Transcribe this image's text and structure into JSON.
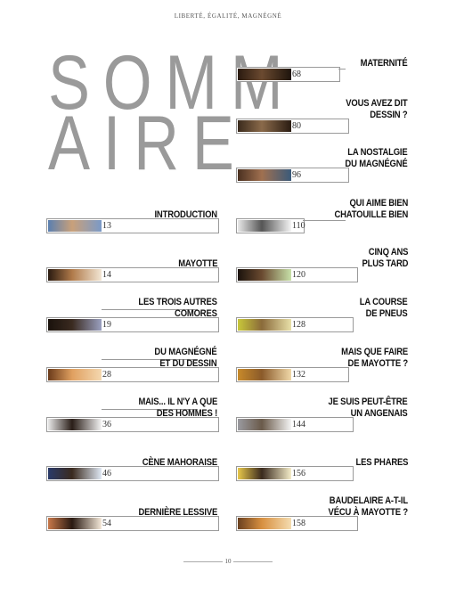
{
  "running_head": "LIBERTÉ, ÉGALITÉ, MAGNÉGNÉ",
  "title": {
    "line1": "SOMM",
    "line2": "AIRE"
  },
  "entries": [
    {
      "page": "68",
      "label": [
        "MATERNITÉ"
      ],
      "thumb_colors": [
        "#2a1a10",
        "#6b4a30",
        "#1e140c"
      ]
    },
    {
      "page": "80",
      "label": [
        "VOUS AVEZ DIT",
        "DESSIN ?"
      ],
      "thumb_colors": [
        "#3a2a1c",
        "#8a6a4a",
        "#2a1c12"
      ]
    },
    {
      "page": "96",
      "label": [
        "LA NOSTALGIE",
        "DU MAGNÉGNÉ"
      ],
      "thumb_colors": [
        "#4a3020",
        "#a07050",
        "#3a5a7a"
      ]
    },
    {
      "page": "13",
      "label": [
        "INTRODUCTION"
      ],
      "thumb_colors": [
        "#5a7fb0",
        "#c9a07a",
        "#7a9ac8"
      ]
    },
    {
      "page": "110",
      "label": [
        "QUI AIME BIEN",
        "CHATOUILLE BIEN"
      ],
      "thumb_colors": [
        "#e8e8e8",
        "#555555",
        "#f4f4f4"
      ]
    },
    {
      "page": "14",
      "label": [
        "MAYOTTE"
      ],
      "thumb_colors": [
        "#2a1a10",
        "#b07a4a",
        "#f2e6d4"
      ]
    },
    {
      "page": "120",
      "label": [
        "CINQ ANS",
        "PLUS TARD"
      ],
      "thumb_colors": [
        "#1a120c",
        "#6a4a30",
        "#c7e0a8"
      ]
    },
    {
      "page": "19",
      "label": [
        "LES TROIS AUTRES",
        "COMORES"
      ],
      "thumb_colors": [
        "#1a120c",
        "#3a2a20",
        "#9aa0c0"
      ]
    },
    {
      "page": "128",
      "label": [
        "LA COURSE",
        "DE PNEUS"
      ],
      "thumb_colors": [
        "#c8c83a",
        "#8a6a3a",
        "#e8e0a8"
      ]
    },
    {
      "page": "28",
      "label": [
        "DU MAGNÉGNÉ",
        "ET DU DESSIN"
      ],
      "thumb_colors": [
        "#6a3a1a",
        "#e0a060",
        "#f4d8b0"
      ]
    },
    {
      "page": "132",
      "label": [
        "MAIS QUE FAIRE",
        "DE MAYOTTE ?"
      ],
      "thumb_colors": [
        "#c88a2a",
        "#8a5a2a",
        "#f0d8a8"
      ]
    },
    {
      "page": "36",
      "label": [
        "MAIS... IL N'Y A QUE",
        "DES HOMMES !"
      ],
      "thumb_colors": [
        "#e8e8e8",
        "#2a1e18",
        "#f4f4f4"
      ]
    },
    {
      "page": "144",
      "label": [
        "JE SUIS PEUT-ÊTRE",
        "UN ANGENAIS"
      ],
      "thumb_colors": [
        "#9a9aa0",
        "#6a5a4a",
        "#f4f4f4"
      ]
    },
    {
      "page": "46",
      "label": [
        "CÈNE MAHORAISE"
      ],
      "thumb_colors": [
        "#2a3a6a",
        "#3a2a1e",
        "#dfe8f4"
      ]
    },
    {
      "page": "156",
      "label": [
        "LES PHARES"
      ],
      "thumb_colors": [
        "#e8c84a",
        "#3a2a1e",
        "#f4ecc8"
      ]
    },
    {
      "page": "54",
      "label": [
        "DERNIÈRE LESSIVE"
      ],
      "thumb_colors": [
        "#c8784a",
        "#2a1a12",
        "#f4e8d8"
      ]
    },
    {
      "page": "158",
      "label": [
        "BAUDELAIRE A-T-IL",
        "VÉCU À MAYOTTE ?"
      ],
      "thumb_colors": [
        "#6a4020",
        "#d89040",
        "#f4dcb0"
      ]
    }
  ],
  "folio": "10"
}
